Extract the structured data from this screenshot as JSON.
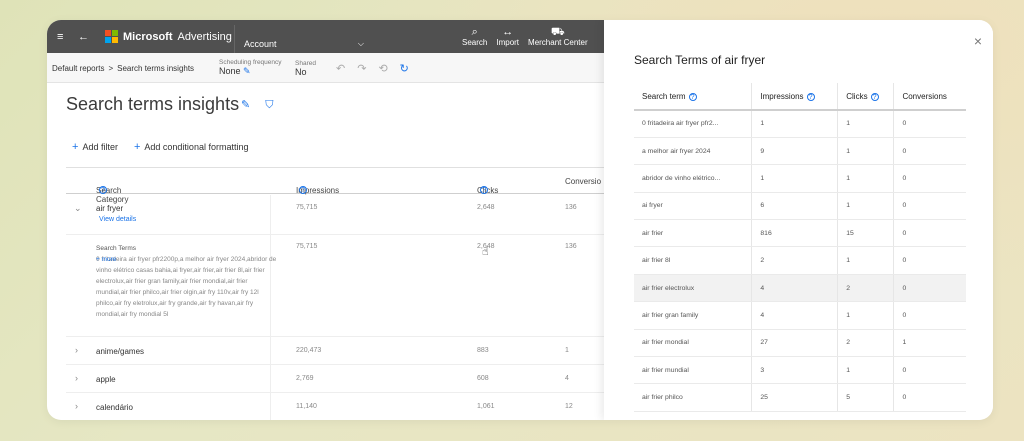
{
  "app": {
    "brand": "Microsoft",
    "product": "Advertising",
    "account_label": "Account",
    "nav": [
      {
        "label": "Search",
        "icon": "search-icon"
      },
      {
        "label": "Import",
        "icon": "import-icon"
      },
      {
        "label": "Merchant Center",
        "icon": "cart-icon"
      }
    ]
  },
  "subbar": {
    "breadcrumb_root": "Default reports",
    "breadcrumb_sep": ">",
    "breadcrumb_current": "Search terms insights",
    "sched_label": "Scheduling frequency",
    "sched_value": "None",
    "shared_label": "Shared",
    "shared_value": "No"
  },
  "page": {
    "title": "Search terms insights",
    "add_filter": "Add filter",
    "add_conditional": "Add conditional formatting",
    "columns": [
      "Search Category",
      "Impressions",
      "Clicks",
      "Conversio"
    ],
    "rows": [
      {
        "category": "air fryer",
        "link": "View details",
        "impressions": "75,715",
        "clicks": "2,648",
        "conversions": "136"
      },
      {
        "category": "anime/games",
        "impressions": "220,473",
        "clicks": "883",
        "conversions": "1"
      },
      {
        "category": "apple",
        "impressions": "2,769",
        "clicks": "608",
        "conversions": "4"
      },
      {
        "category": "calendário",
        "impressions": "11,140",
        "clicks": "1,061",
        "conversions": "12"
      }
    ],
    "expanded": {
      "heading": "Search Terms",
      "text": "0 fritadeira air fryer pfr2200p,a melhor air fryer 2024,abridor de vinho elétrico casas bahia,ai fryer,air frier,air frier 8l,air frier electrolux,air frier gran family,air frier mondial,air frier mundial,air frier philco,air frier olgin,air fry 110v,air fry 12l philco,air fry eletrolux,air fry grande,air fry havan,air fry mondial,air fry mondial 5l",
      "more": "+ more",
      "impressions": "75,715",
      "clicks": "2,648",
      "conversions": "136"
    }
  },
  "panel": {
    "title": "Search Terms of air fryer",
    "close": "×",
    "columns": [
      "Search term",
      "Impressions",
      "Clicks",
      "Conversions"
    ],
    "rows": [
      [
        "0 fritadeira air fryer pfr2...",
        "1",
        "1",
        "0"
      ],
      [
        "a melhor air fryer 2024",
        "9",
        "1",
        "0"
      ],
      [
        "abridor de vinho elétrico...",
        "1",
        "1",
        "0"
      ],
      [
        "ai fryer",
        "6",
        "1",
        "0"
      ],
      [
        "air frier",
        "816",
        "15",
        "0"
      ],
      [
        "air frier 8l",
        "2",
        "1",
        "0"
      ],
      [
        "air frier electrolux",
        "4",
        "2",
        "0"
      ],
      [
        "air frier gran family",
        "4",
        "1",
        "0"
      ],
      [
        "air frier mondial",
        "27",
        "2",
        "1"
      ],
      [
        "air frier mundial",
        "3",
        "1",
        "0"
      ],
      [
        "air frier philco",
        "25",
        "5",
        "0"
      ]
    ],
    "highlighted_row": 6
  },
  "colors": {
    "topbar": "#505050",
    "accent": "#1a73e8",
    "ms_red": "#f25022",
    "ms_green": "#7fba00",
    "ms_blue": "#00a4ef",
    "ms_yellow": "#ffb900"
  }
}
